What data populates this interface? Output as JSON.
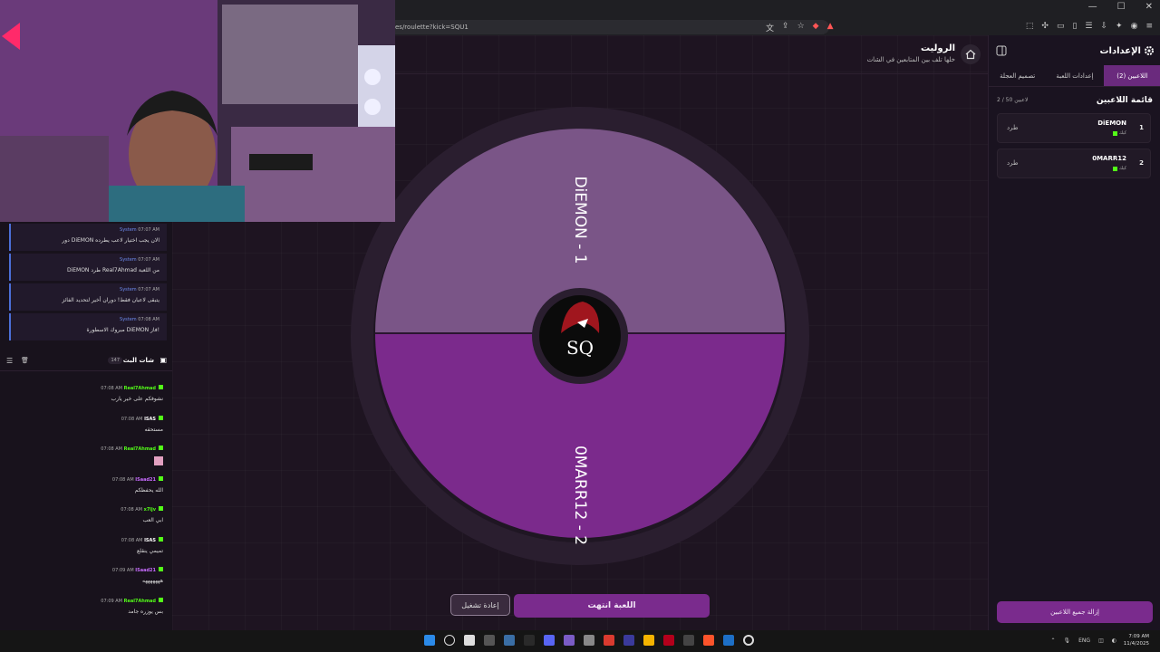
{
  "browser": {
    "url": "es/roulette?kick=SQU1",
    "icons": [
      "translate-icon",
      "share-icon",
      "star-icon",
      "brave-shield-icon",
      "brave-rewards-icon"
    ],
    "toolbar_right_icons": [
      "extensions-icon",
      "puzzle-icon",
      "wallet-icon",
      "sidebar-icon",
      "reading-list-icon",
      "downloads-icon",
      "leo-icon",
      "profile-icon",
      "menu-icon"
    ]
  },
  "main": {
    "title": "الروليت",
    "subtitle": "خلها تلف بين المتابعين في الشات",
    "wheel": {
      "segments": [
        {
          "label": "DiEMON - 1",
          "color": "#7a5587"
        },
        {
          "label": "0MARR12 - 2",
          "color": "#7b2a8c"
        }
      ],
      "center_logo_text": "SQ"
    },
    "restart_label": "إعادة تشغيل",
    "game_over_label": "اللعبة انتهت"
  },
  "settings": {
    "title": "الإعدادات",
    "tabs": [
      {
        "label": "اللاعبين (2)",
        "active": true
      },
      {
        "label": "إعدادات اللعبة",
        "active": false
      },
      {
        "label": "تصميم العجلة",
        "active": false
      }
    ],
    "players_title": "قائمة اللاعبين",
    "players_count": "2 / 50 لاعبين",
    "players": [
      {
        "num": "1",
        "name": "DiEMON",
        "platform": "كيك",
        "kick_label": "طرد"
      },
      {
        "num": "2",
        "name": "0MARR12",
        "platform": "كيك",
        "kick_label": "طرد"
      }
    ],
    "remove_all_label": "إزالة جميع اللاعبين"
  },
  "chat": {
    "system_messages": [
      {
        "time": "07:07 AM",
        "user": "System",
        "text": "دور DiEMON الان يجب اختيار لاعب يطرده"
      },
      {
        "time": "07:07 AM",
        "user": "System",
        "text": "DiEMON طرد Real7Ahmad من اللعبة"
      },
      {
        "time": "07:07 AM",
        "user": "System",
        "text": "يتبقى لاعبان فقط! دوران أخير لتحديد الفائز"
      },
      {
        "time": "07:08 AM",
        "user": "System",
        "text": "مبروك الاسطورة DiEMON فاز!"
      }
    ],
    "title": "شات البث",
    "viewers": "147",
    "messages": [
      {
        "user": "Real7Ahmad",
        "time": "07:08 AM",
        "text": "نشوفكم على خير يارب",
        "color": "#53fc18"
      },
      {
        "user": "ISAS",
        "time": "07:08 AM",
        "text": "مستحقه",
        "color": "#ffffff"
      },
      {
        "user": "Real7Ahmad",
        "time": "07:08 AM",
        "text": "",
        "color": "#53fc18"
      },
      {
        "user": "ISaad21",
        "time": "07:08 AM",
        "text": "الله يحفظكم",
        "color": "#c86cff"
      },
      {
        "user": "x7ljv",
        "time": "07:08 AM",
        "text": "ابي العب",
        "color": "#53fc18"
      },
      {
        "user": "ISAS",
        "time": "07:08 AM",
        "text": "تميمي ينقلع",
        "color": "#ffffff"
      },
      {
        "user": "ISaad21",
        "time": "07:09 AM",
        "text": "هههههههه",
        "color": "#c86cff"
      },
      {
        "user": "Real7Ahmad",
        "time": "07:09 AM",
        "text": "بس يوزره جامد",
        "color": "#53fc18"
      }
    ]
  },
  "taskbar": {
    "lang": "ENG",
    "time": "7:09 AM",
    "date": "11/4/2025"
  }
}
